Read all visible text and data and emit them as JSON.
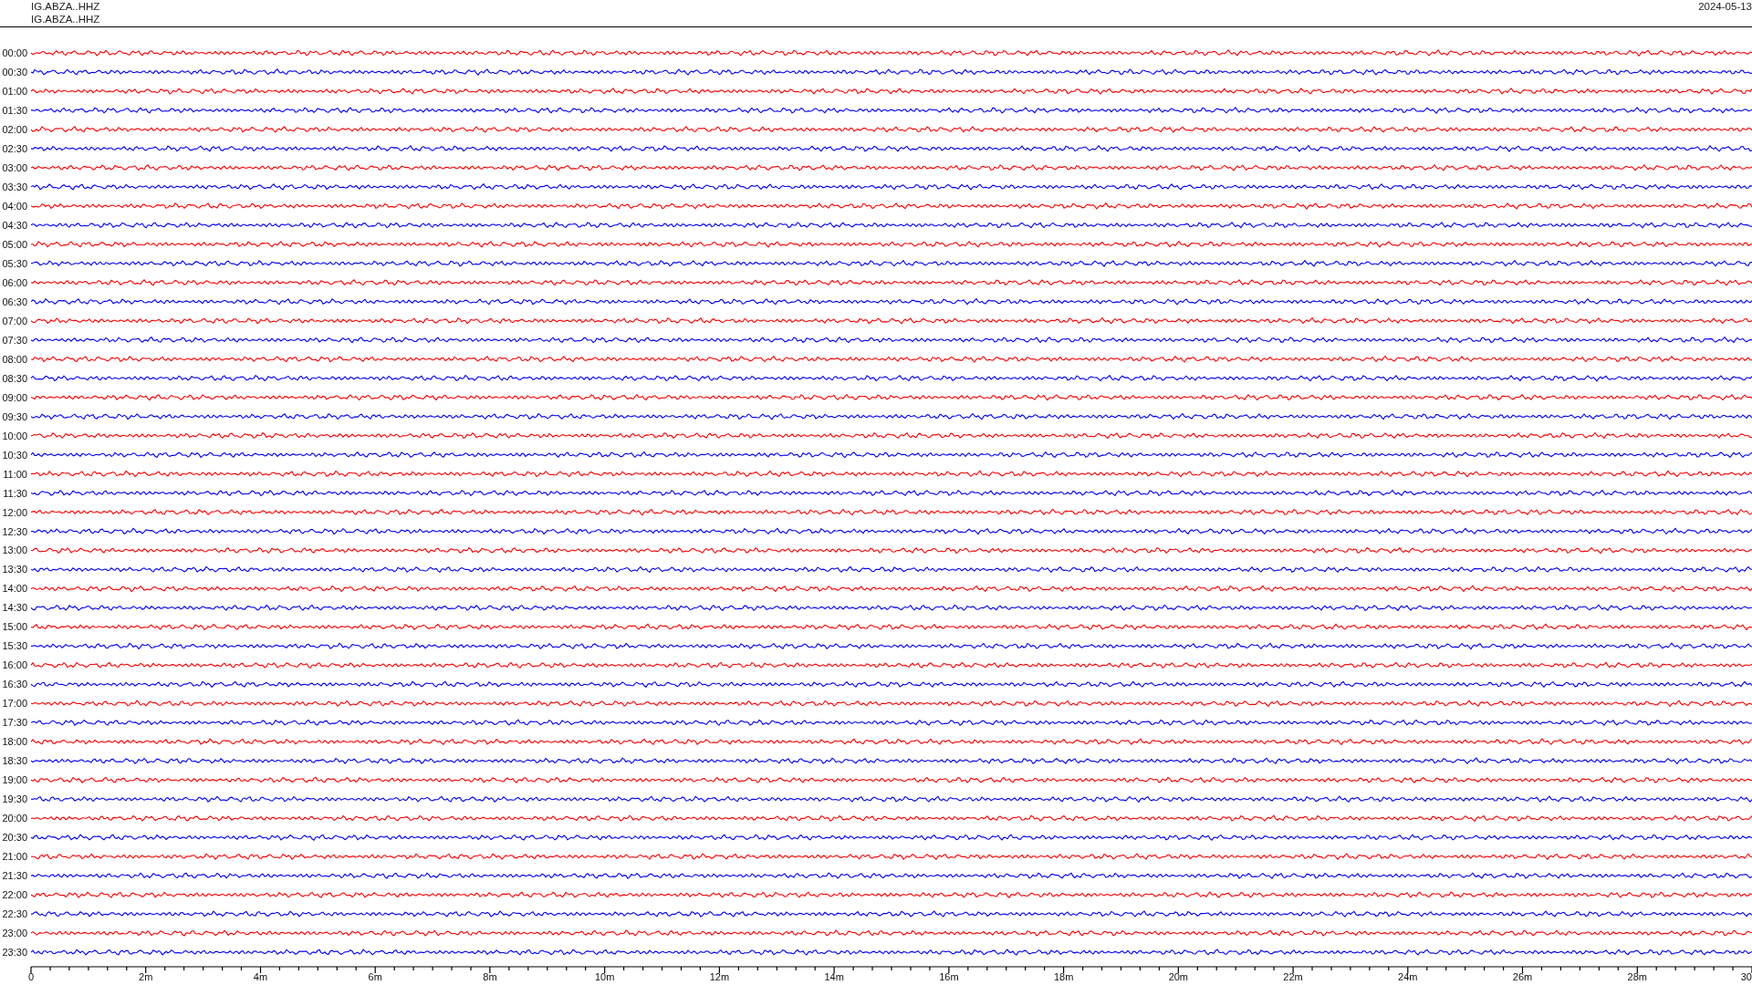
{
  "header": {
    "station_lines": [
      "IG.ABZA..HHZ",
      "IG.ABZA..HHZ"
    ],
    "date": "2024-05-13"
  },
  "rows": [
    {
      "label": "00:00",
      "color": "#ff0000"
    },
    {
      "label": "00:30",
      "color": "#0000ff"
    },
    {
      "label": "01:00",
      "color": "#ff0000"
    },
    {
      "label": "01:30",
      "color": "#0000ff"
    },
    {
      "label": "02:00",
      "color": "#ff0000"
    },
    {
      "label": "02:30",
      "color": "#0000ff"
    },
    {
      "label": "03:00",
      "color": "#ff0000"
    },
    {
      "label": "03:30",
      "color": "#0000ff"
    },
    {
      "label": "04:00",
      "color": "#ff0000"
    },
    {
      "label": "04:30",
      "color": "#0000ff"
    },
    {
      "label": "05:00",
      "color": "#ff0000"
    },
    {
      "label": "05:30",
      "color": "#0000ff"
    },
    {
      "label": "06:00",
      "color": "#ff0000"
    },
    {
      "label": "06:30",
      "color": "#0000ff"
    },
    {
      "label": "07:00",
      "color": "#ff0000"
    },
    {
      "label": "07:30",
      "color": "#0000ff"
    },
    {
      "label": "08:00",
      "color": "#ff0000"
    },
    {
      "label": "08:30",
      "color": "#0000ff"
    },
    {
      "label": "09:00",
      "color": "#ff0000"
    },
    {
      "label": "09:30",
      "color": "#0000ff"
    },
    {
      "label": "10:00",
      "color": "#ff0000"
    },
    {
      "label": "10:30",
      "color": "#0000ff"
    },
    {
      "label": "11:00",
      "color": "#ff0000"
    },
    {
      "label": "11:30",
      "color": "#0000ff"
    },
    {
      "label": "12:00",
      "color": "#ff0000"
    },
    {
      "label": "12:30",
      "color": "#0000ff"
    },
    {
      "label": "13:00",
      "color": "#ff0000"
    },
    {
      "label": "13:30",
      "color": "#0000ff"
    },
    {
      "label": "14:00",
      "color": "#ff0000"
    },
    {
      "label": "14:30",
      "color": "#0000ff"
    },
    {
      "label": "15:00",
      "color": "#ff0000"
    },
    {
      "label": "15:30",
      "color": "#0000ff"
    },
    {
      "label": "16:00",
      "color": "#ff0000"
    },
    {
      "label": "16:30",
      "color": "#0000ff"
    },
    {
      "label": "17:00",
      "color": "#ff0000"
    },
    {
      "label": "17:30",
      "color": "#0000ff"
    },
    {
      "label": "18:00",
      "color": "#ff0000"
    },
    {
      "label": "18:30",
      "color": "#0000ff"
    },
    {
      "label": "19:00",
      "color": "#ff0000"
    },
    {
      "label": "19:30",
      "color": "#0000ff"
    },
    {
      "label": "20:00",
      "color": "#ff0000"
    },
    {
      "label": "20:30",
      "color": "#0000ff"
    },
    {
      "label": "21:00",
      "color": "#ff0000"
    },
    {
      "label": "21:30",
      "color": "#0000ff"
    },
    {
      "label": "22:00",
      "color": "#ff0000"
    },
    {
      "label": "22:30",
      "color": "#0000ff"
    },
    {
      "label": "23:00",
      "color": "#ff0000"
    },
    {
      "label": "23:30",
      "color": "#0000ff"
    }
  ],
  "axis": {
    "tick_labels": [
      "0",
      "2m",
      "4m",
      "6m",
      "8m",
      "10m",
      "12m",
      "14m",
      "16m",
      "18m",
      "20m",
      "22m",
      "24m",
      "26m",
      "28m",
      "30"
    ]
  }
}
